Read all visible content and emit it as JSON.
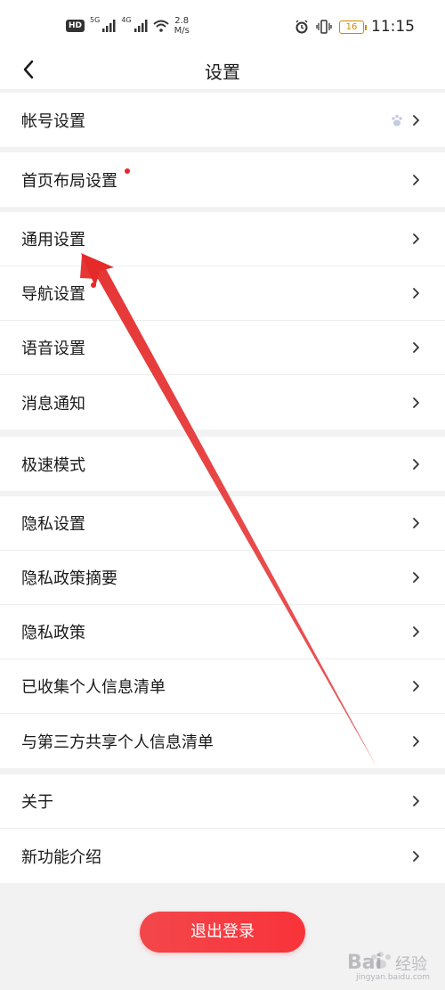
{
  "status_bar": {
    "hd": "HD",
    "net1": "5G",
    "net2": "4G",
    "speed_value": "2.8",
    "speed_unit": "M/s",
    "battery": "16",
    "time": "11:15"
  },
  "header": {
    "title": "设置"
  },
  "groups": [
    {
      "items": [
        {
          "label": "帐号设置",
          "dot": false,
          "paw_icon": true
        }
      ]
    },
    {
      "items": [
        {
          "label": "首页布局设置",
          "dot": true
        }
      ]
    },
    {
      "items": [
        {
          "label": "通用设置",
          "dot": false
        },
        {
          "label": "导航设置",
          "dot": true
        },
        {
          "label": "语音设置",
          "dot": false
        },
        {
          "label": "消息通知",
          "dot": false
        }
      ]
    },
    {
      "items": [
        {
          "label": "极速模式",
          "dot": false
        }
      ]
    },
    {
      "items": [
        {
          "label": "隐私设置",
          "dot": false
        },
        {
          "label": "隐私政策摘要",
          "dot": false
        },
        {
          "label": "隐私政策",
          "dot": false
        },
        {
          "label": "已收集个人信息清单",
          "dot": false
        },
        {
          "label": "与第三方共享个人信息清单",
          "dot": false
        }
      ]
    },
    {
      "items": [
        {
          "label": "关于",
          "dot": false
        },
        {
          "label": "新功能介绍",
          "dot": false
        }
      ]
    }
  ],
  "logout_label": "退出登录",
  "colors": {
    "accent": "#f3474b",
    "dot": "#e8262d",
    "annotation_arrow": "#e52a2a"
  },
  "watermark": {
    "brand": "Bai",
    "cn": "经验",
    "domain": "jingyan.baidu.com"
  }
}
